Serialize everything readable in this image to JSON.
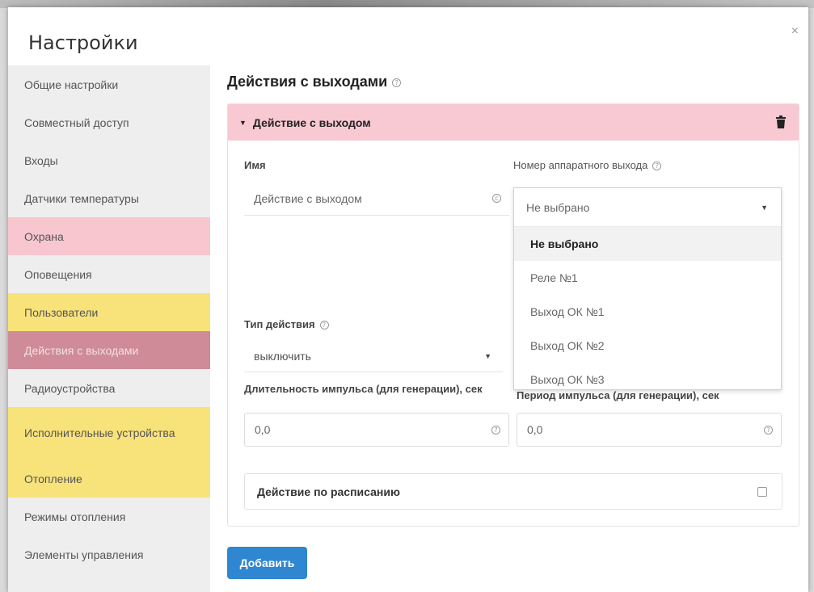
{
  "modal": {
    "title": "Настройки",
    "close_glyph": "×"
  },
  "sidebar": {
    "items": [
      {
        "label": "Общие настройки"
      },
      {
        "label": "Совместный доступ"
      },
      {
        "label": "Входы"
      },
      {
        "label": "Датчики температуры"
      },
      {
        "label": "Охрана"
      },
      {
        "label": "Оповещения"
      },
      {
        "label": "Пользователи"
      },
      {
        "label": "Действия с выходами"
      },
      {
        "label": "Радиоустройства"
      },
      {
        "label": "Исполнительные устройства"
      },
      {
        "label": "Отопление"
      },
      {
        "label": "Режимы отопления"
      },
      {
        "label": "Элементы управления"
      }
    ]
  },
  "section": {
    "title": "Действия с выходами",
    "help_glyph": "?"
  },
  "panel": {
    "header": "Действие с выходом",
    "name_label": "Имя",
    "name_value": "Действие с выходом",
    "output_label": "Номер аппаратного выхода",
    "output_selected": "Не выбрано",
    "output_options": [
      "Не выбрано",
      "Реле №1",
      "Выход ОК №1",
      "Выход ОК №2",
      "Выход ОК №3"
    ],
    "action_type_label": "Тип действия",
    "action_type_value": "выключить",
    "pulse_duration_label": "Длительность импульса (для генерации), сек",
    "pulse_duration_value": "0,0",
    "pulse_period_label": "Период импульса (для генерации), сек",
    "pulse_period_value": "0,0",
    "schedule_label": "Действие по расписанию"
  },
  "add_button": "Добавить",
  "icons": [
    "close-icon",
    "help-icon",
    "caret-down-icon",
    "trash-icon",
    "checkbox-icon"
  ],
  "colors": {
    "accent": "#2f86d1",
    "pink": "#f7c6cf",
    "yellow": "#f8e27a",
    "active": "#cf8b98",
    "panel_header": "#f8c9d2"
  }
}
